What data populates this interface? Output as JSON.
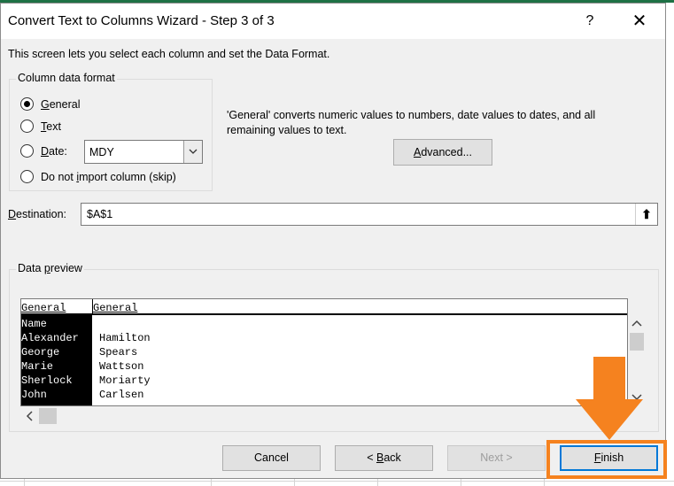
{
  "window": {
    "title": "Convert Text to Columns Wizard - Step 3 of 3",
    "help_label": "?",
    "close_label": "✕"
  },
  "intro": "This screen lets you select each column and set the Data Format.",
  "column_format": {
    "group_title": "Column data format",
    "options": [
      {
        "key": "G",
        "rest": "eneral",
        "selected": true
      },
      {
        "key": "T",
        "rest": "ext",
        "selected": false
      },
      {
        "key": "D",
        "rest": "ate:",
        "selected": false
      },
      {
        "pre": "Do not ",
        "key": "i",
        "rest": "mport column (skip)",
        "selected": false
      }
    ],
    "date_format": "MDY"
  },
  "description": "'General' converts numeric values to numbers, date values to dates, and all remaining values to text.",
  "advanced_button": {
    "key": "A",
    "rest": "dvanced..."
  },
  "destination": {
    "label_key": "D",
    "label_rest": "estination:",
    "value": "$A$1",
    "collapse_icon": "⬆"
  },
  "data_preview": {
    "group_title_pre": "Data ",
    "group_title_key": "p",
    "group_title_rest": "review",
    "headers": [
      "General",
      "General"
    ],
    "rows": [
      [
        "Name",
        ""
      ],
      [
        "Alexander",
        "Hamilton"
      ],
      [
        "George",
        "Spears"
      ],
      [
        "Marie",
        "Wattson"
      ],
      [
        "Sherlock",
        "Moriarty"
      ],
      [
        "John",
        "Carlsen"
      ]
    ]
  },
  "buttons": {
    "cancel": "Cancel",
    "back_pre": "< ",
    "back_key": "B",
    "back_rest": "ack",
    "next": "Next >",
    "finish_key": "F",
    "finish_rest": "inish"
  },
  "colors": {
    "accent_orange": "#f5821f",
    "excel_green": "#1e7145",
    "preview_selected": "#000000"
  }
}
